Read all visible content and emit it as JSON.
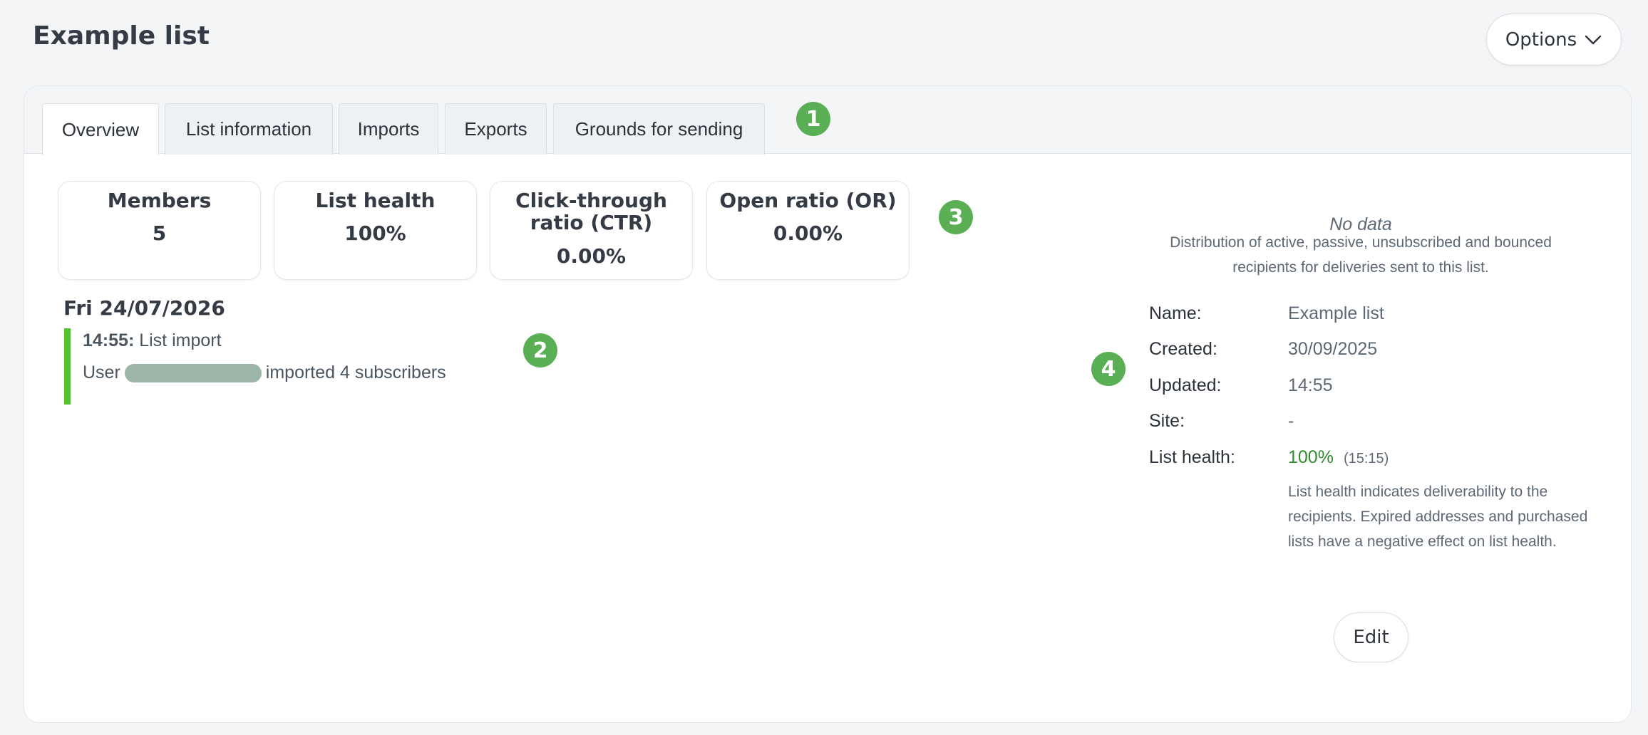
{
  "page": {
    "title": "Example list"
  },
  "header": {
    "options_label": "Options"
  },
  "tabs": [
    {
      "label": "Overview",
      "active": true
    },
    {
      "label": "List information"
    },
    {
      "label": "Imports"
    },
    {
      "label": "Exports"
    },
    {
      "label": "Grounds for sending"
    }
  ],
  "markers": [
    "1",
    "2",
    "3",
    "4"
  ],
  "stats": [
    {
      "label": "Members",
      "value": "5"
    },
    {
      "label": "List health",
      "value": "100%"
    },
    {
      "label_line1": "Click-through",
      "label_line2": "ratio (CTR)",
      "value": "0.00%"
    },
    {
      "label": "Open ratio (OR)",
      "value": "0.00%"
    }
  ],
  "activity": {
    "date": "Fri 24/07/2026",
    "time": "14:55:",
    "title": "List import",
    "detail_prefix": "User",
    "detail_suffix": "imported 4 subscribers"
  },
  "distribution": {
    "no_data": "No data",
    "description": "Distribution of active, passive, unsubscribed and bounced recipients for deliveries sent to this list."
  },
  "info": {
    "name_label": "Name:",
    "name_value": "Example list",
    "created_label": "Created:",
    "created_value": "30/09/2025",
    "updated_label": "Updated:",
    "updated_value": "14:55",
    "site_label": "Site:",
    "site_value": "-",
    "health_label": "List health:",
    "health_value": "100%",
    "health_time": "(15:15)",
    "health_description": "List health indicates deliverability to the recipients. Expired addresses and purchased lists have a negative effect on list health."
  },
  "edit_label": "Edit",
  "colors": {
    "accent_green": "#5aaf55",
    "activity_bar": "#55c232",
    "health_green": "#2e8b2e"
  }
}
